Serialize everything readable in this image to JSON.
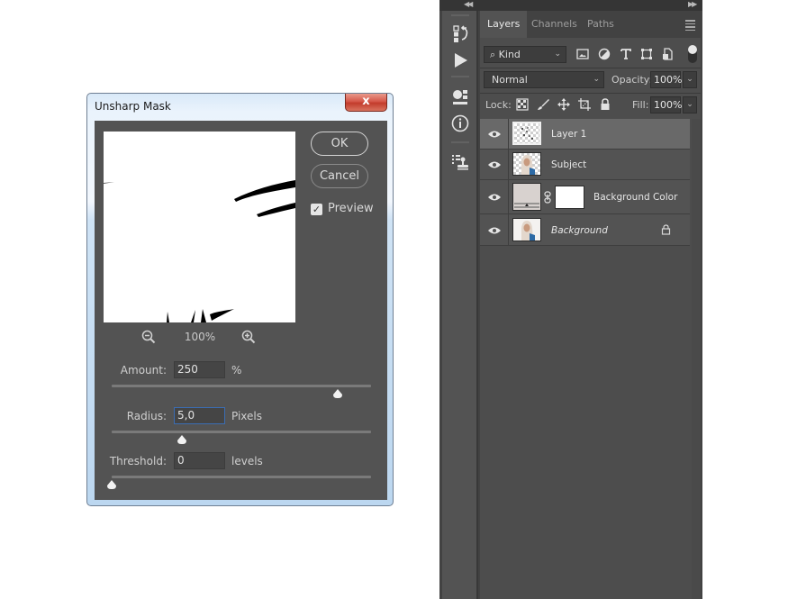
{
  "dialog": {
    "title": "Unsharp Mask",
    "close_label": "x",
    "ok_label": "OK",
    "cancel_label": "Cancel",
    "preview_label": "Preview",
    "preview_checked": true,
    "zoom_level": "100%",
    "amount": {
      "label": "Amount:",
      "value": "250",
      "unit": "%",
      "slider_fraction": 0.87
    },
    "radius": {
      "label": "Radius:",
      "value": "5,0",
      "unit": "Pixels",
      "slider_fraction": 0.27
    },
    "threshold": {
      "label": "Threshold:",
      "value": "0",
      "unit": "levels",
      "slider_fraction": 0.0
    },
    "colors": {
      "body": "#535353",
      "close_red": "#c94838",
      "active_field_border": "#3b6db3"
    }
  },
  "photoshop": {
    "panel_tabs": [
      "Layers",
      "Channels",
      "Paths"
    ],
    "active_tab": "Layers",
    "filter": {
      "kind_label": "Kind",
      "icons": [
        "pixel-layer-filter-icon",
        "adjustment-filter-icon",
        "type-filter-icon",
        "shape-filter-icon",
        "smart-object-filter-icon"
      ]
    },
    "blend_mode": "Normal",
    "opacity_label": "Opacity:",
    "opacity_value": "100%",
    "lock_label": "Lock:",
    "lock_icons": [
      "lock-transparent-pixels-icon",
      "lock-image-pixels-icon",
      "lock-position-icon",
      "lock-artboard-icon",
      "lock-all-icon"
    ],
    "fill_label": "Fill:",
    "fill_value": "100%",
    "layers": [
      {
        "name": "Layer 1",
        "visible": true,
        "selected": true,
        "thumb": "transparent-specks",
        "italic": false,
        "locked": false
      },
      {
        "name": "Subject",
        "visible": true,
        "selected": false,
        "thumb": "portrait-transparent",
        "italic": false,
        "locked": false
      },
      {
        "name": "Background Color",
        "visible": true,
        "selected": false,
        "thumb": "fill-with-mask",
        "italic": false,
        "locked": false
      },
      {
        "name": "Background",
        "visible": true,
        "selected": false,
        "thumb": "portrait",
        "italic": true,
        "locked": true
      }
    ],
    "dock_icons": [
      "history-icon",
      "actions-play-icon",
      "properties-icon",
      "info-icon",
      "clone-source-icon"
    ]
  }
}
